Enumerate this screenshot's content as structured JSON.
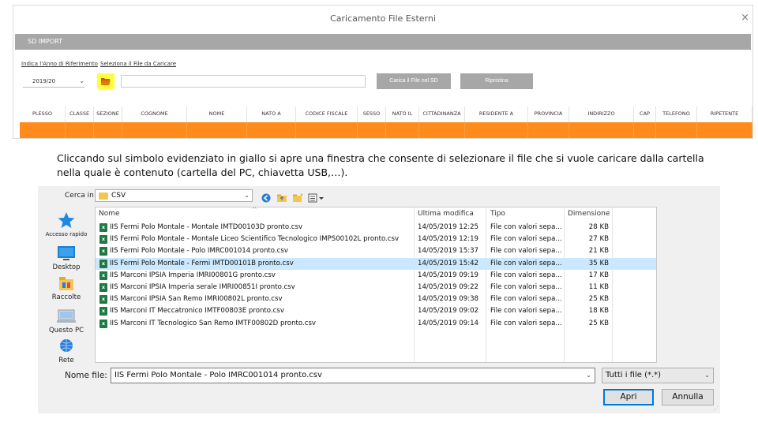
{
  "app": {
    "title": "Caricamento File Esterni",
    "close": "×",
    "section": "SD IMPORT",
    "year_link": "Indica l'Anno di Riferimento",
    "file_link": "Seleziona il File da Caricare",
    "year_value": "2019/20",
    "upload_button": "Carica il File nel SD",
    "reset_button": "Ripristina",
    "columns": [
      "PLESSO",
      "CLASSE",
      "SEZIONE",
      "COGNOME",
      "NOME",
      "NATO A",
      "CODICE FISCALE",
      "SESSO",
      "NATO IL",
      "CITTADINANZA",
      "RESIDENTE A",
      "PROVINCIA",
      "INDIRIZZO",
      "CAP",
      "TELEFONO",
      "RIPETENTE"
    ]
  },
  "caption": "Cliccando sul simbolo evidenziato in giallo si apre una finestra che consente di selezionare il file che si vuole caricare dalla cartella nella quale è contenuto (cartella del PC, chiavetta USB,…).",
  "dialog": {
    "lookin_label": "Cerca in:",
    "lookin_value": "CSV",
    "places": [
      "Accesso rapido",
      "Desktop",
      "Raccolte",
      "Questo PC",
      "Rete"
    ],
    "headers": {
      "name": "Nome",
      "modified": "Ultima modifica",
      "type": "Tipo",
      "size": "Dimensione"
    },
    "files": [
      {
        "name": "IIS Fermi Polo Montale - Montale IMTD00103D pronto.csv",
        "modified": "14/05/2019 12:25",
        "type": "File con valori sepa...",
        "size": "28 KB"
      },
      {
        "name": "IIS Fermi Polo Montale - Montale Liceo Scientifico Tecnologico IMPS00102L pronto.csv",
        "modified": "14/05/2019 12:19",
        "type": "File con valori sepa...",
        "size": "27 KB"
      },
      {
        "name": "IIS Fermi Polo Montale - Polo IMRC001014 pronto.csv",
        "modified": "14/05/2019 15:37",
        "type": "File con valori sepa...",
        "size": "21 KB"
      },
      {
        "name": "IIS Fermi Polo Montale - Fermi IMTD00101B pronto.csv",
        "modified": "14/05/2019 15:42",
        "type": "File con valori sepa...",
        "size": "35 KB"
      },
      {
        "name": "IIS Marconi IPSIA Imperia IMRI00801G pronto.csv",
        "modified": "14/05/2019 09:19",
        "type": "File con valori sepa...",
        "size": "17 KB"
      },
      {
        "name": "IIS Marconi IPSIA Imperia serale IMRI00851I pronto.csv",
        "modified": "14/05/2019 09:22",
        "type": "File con valori sepa...",
        "size": "11 KB"
      },
      {
        "name": "IIS Marconi IPSIA San Remo IMRI00802L pronto.csv",
        "modified": "14/05/2019 09:38",
        "type": "File con valori sepa...",
        "size": "25 KB"
      },
      {
        "name": "IIS Marconi IT Meccatronico IMTF00803E pronto.csv",
        "modified": "14/05/2019 09:02",
        "type": "File con valori sepa...",
        "size": "18 KB"
      },
      {
        "name": "IIS Marconi IT Tecnologico San Remo IMTF00802D pronto.csv",
        "modified": "14/05/2019 09:14",
        "type": "File con valori sepa...",
        "size": "25 KB"
      }
    ],
    "selected_index": 3,
    "filename_label": "Nome file:",
    "filename_value": "IIS Fermi Polo Montale - Polo IMRC001014 pronto.csv",
    "filetype_value": "Tutti i file (*.*)",
    "open_button": "Apri",
    "cancel_button": "Annulla"
  },
  "colors": {
    "orange": "#ff8c1a",
    "highlight_yellow": "#ffff3a",
    "selected_row": "#cce8ff",
    "accent_blue": "#0078d7"
  }
}
